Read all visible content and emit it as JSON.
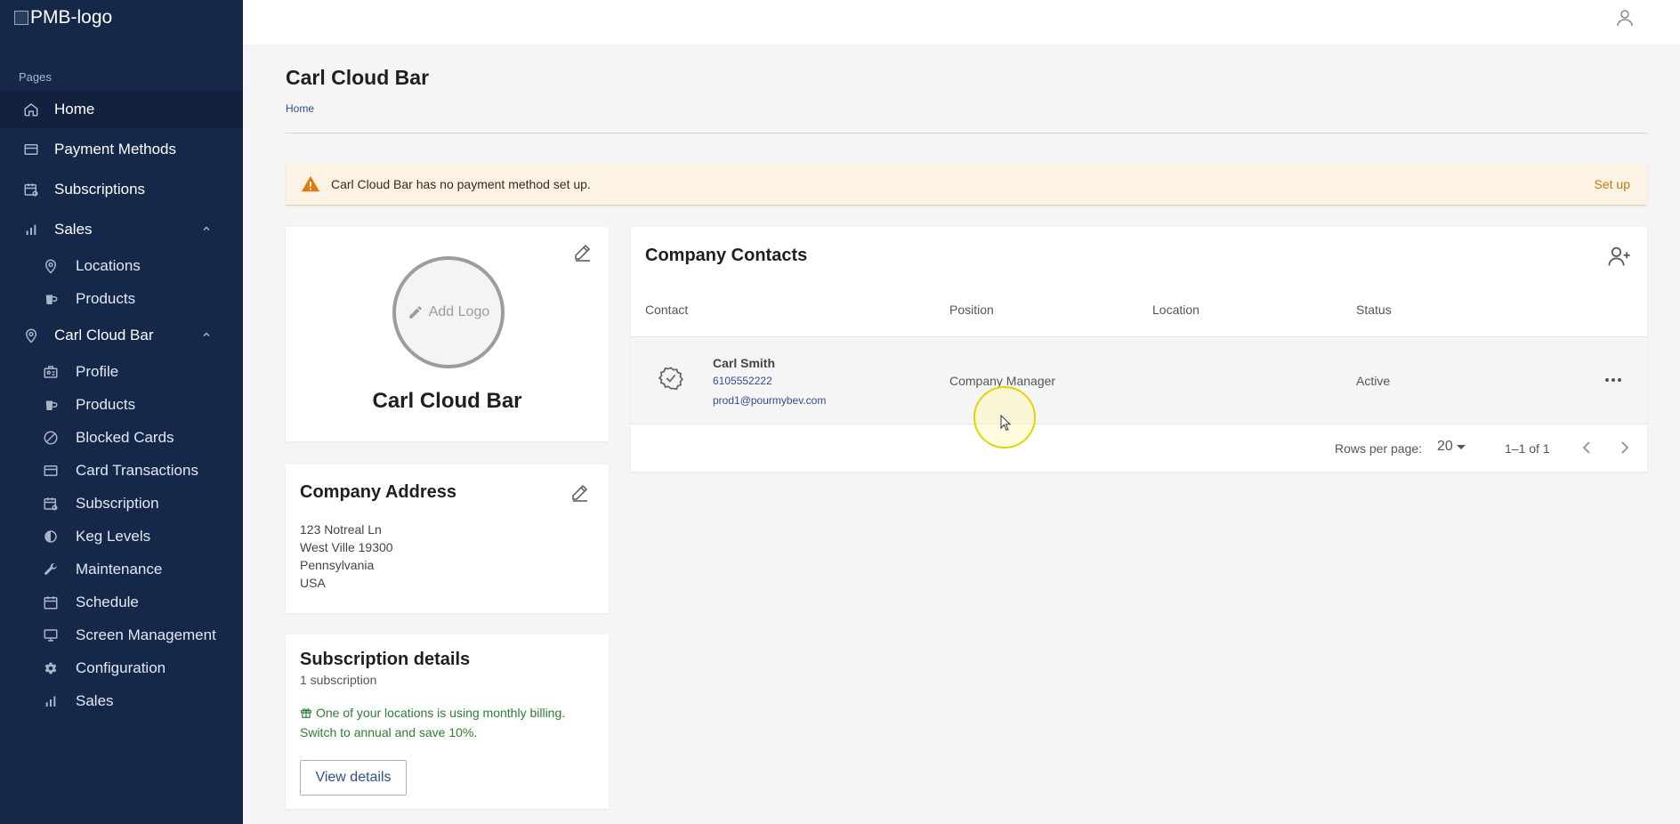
{
  "logo": {
    "alt": "PMB-logo"
  },
  "sidebar": {
    "section_label": "Pages",
    "items": [
      {
        "label": "Home",
        "icon": "home-icon"
      },
      {
        "label": "Payment Methods",
        "icon": "card-icon"
      },
      {
        "label": "Subscriptions",
        "icon": "calendar-refresh-icon"
      },
      {
        "label": "Sales",
        "icon": "bar-chart-icon",
        "expanded": true,
        "children": [
          {
            "label": "Locations",
            "icon": "location-pin-icon"
          },
          {
            "label": "Products",
            "icon": "products-icon"
          }
        ]
      },
      {
        "label": "Carl Cloud Bar",
        "icon": "location-pin-icon",
        "expanded": true,
        "children": [
          {
            "label": "Profile",
            "icon": "profile-icon"
          },
          {
            "label": "Products",
            "icon": "products-icon"
          },
          {
            "label": "Blocked Cards",
            "icon": "blocked-icon"
          },
          {
            "label": "Card Transactions",
            "icon": "card-icon"
          },
          {
            "label": "Subscription",
            "icon": "calendar-refresh-icon"
          },
          {
            "label": "Keg Levels",
            "icon": "contrast-icon"
          },
          {
            "label": "Maintenance",
            "icon": "wrench-icon"
          },
          {
            "label": "Schedule",
            "icon": "calendar-icon"
          },
          {
            "label": "Screen Management",
            "icon": "monitor-icon"
          },
          {
            "label": "Configuration",
            "icon": "gear-icon"
          },
          {
            "label": "Sales",
            "icon": "bar-chart-icon"
          }
        ]
      }
    ]
  },
  "header": {
    "title": "Carl Cloud Bar",
    "breadcrumb": "Home"
  },
  "alert": {
    "message": "Carl Cloud Bar has no payment method set up.",
    "action": "Set up"
  },
  "logo_card": {
    "add_logo": "Add Logo",
    "company_name": "Carl Cloud Bar"
  },
  "address_card": {
    "title": "Company Address",
    "lines": [
      "123 Notreal Ln",
      "West Ville 19300",
      "Pennsylvania",
      "USA"
    ]
  },
  "subscription_card": {
    "title": "Subscription details",
    "count": "1 subscription",
    "promo_line1": "One of your locations is using monthly billing.",
    "promo_line2": "Switch to annual and save 10%.",
    "button": "View details"
  },
  "contacts": {
    "title": "Company Contacts",
    "columns": [
      "Contact",
      "Position",
      "Location",
      "Status"
    ],
    "rows": [
      {
        "name": "Carl Smith",
        "phone": "6105552222",
        "email": "prod1@pourmybev.com",
        "position": "Company Manager",
        "location": "",
        "status": "Active"
      }
    ],
    "pagination": {
      "rows_per_page_label": "Rows per page:",
      "rows_per_page": "20",
      "range": "1–1 of 1"
    }
  },
  "colors": {
    "sidebar_bg": "#16284a",
    "accent_link": "#2f4f8a",
    "warning": "#e07b12",
    "promo_green": "#2e7d32"
  }
}
